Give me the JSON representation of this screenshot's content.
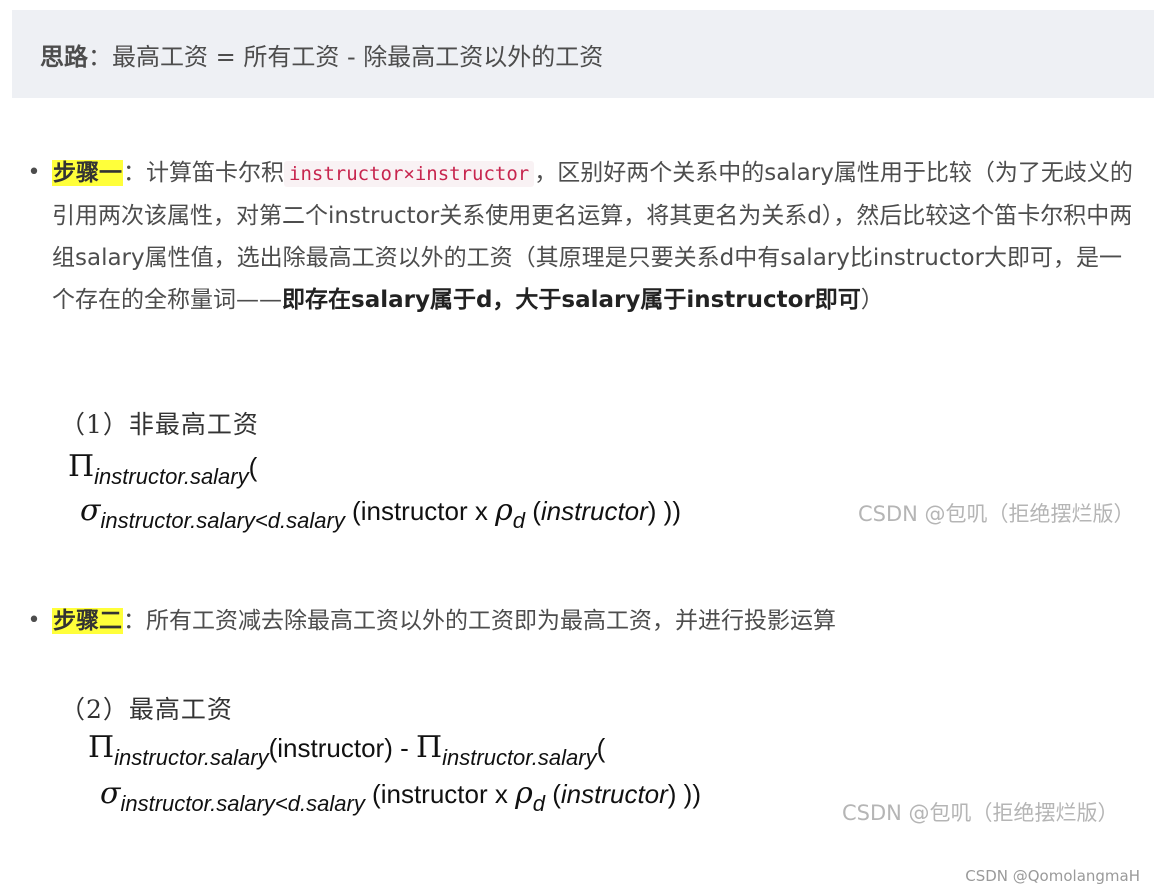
{
  "note": {
    "label": "思路",
    "colon": "：",
    "text": "最高工资 = 所有工资 - 除最高工资以外的工资"
  },
  "step1": {
    "bullet": "•",
    "label": "步骤一",
    "text_a": "：计算笛卡尔积",
    "code": "instructor×instructor",
    "text_b": "，区别好两个关系中的salary属性用于比较（为了无歧义的引用两次该属性，对第二个instructor关系使用更名运算，将其更名为关系d），然后比较这个笛卡尔积中两组salary属性值，选出除最高工资以外的工资（其原理是只要关系d中有salary比instructor大即可，是一个存在的全称量词——",
    "bold": "即存在salary属于d，大于salary属于instructor即可",
    "text_c": "）"
  },
  "figure1": {
    "heading": "（1）非最高工资",
    "pi": "Π",
    "pi_sub": "instructor.salary",
    "pi_tail": "(",
    "sigma": "σ",
    "sigma_sub": "instructor.salary<d.salary",
    "expr_a": " (instructor x ",
    "rho": "ρ",
    "rho_sub": "d",
    "expr_b": " (",
    "expr_c": "instructor",
    "expr_d": ") ))",
    "watermark": "CSDN @包叽（拒绝摆烂版）"
  },
  "step2": {
    "bullet": "•",
    "label": "步骤二",
    "text": "：所有工资减去除最高工资以外的工资即为最高工资，并进行投影运算"
  },
  "figure2": {
    "heading": "（2）最高工资",
    "pi": "Π",
    "pi_sub": "instructor.salary",
    "mid": "(instructor) - ",
    "pi2": "Π",
    "pi2_sub": "instructor.salary",
    "pi2_tail": "(",
    "sigma": "σ",
    "sigma_sub": "instructor.salary<d.salary",
    "expr_a": " (instructor x ",
    "rho": "ρ",
    "rho_sub": "d",
    "expr_b": " (",
    "expr_c": "instructor",
    "expr_d": ") ))",
    "watermark": "CSDN @包叽（拒绝摆烂版）"
  },
  "footer": {
    "watermark": "CSDN @QomolangmaH"
  }
}
